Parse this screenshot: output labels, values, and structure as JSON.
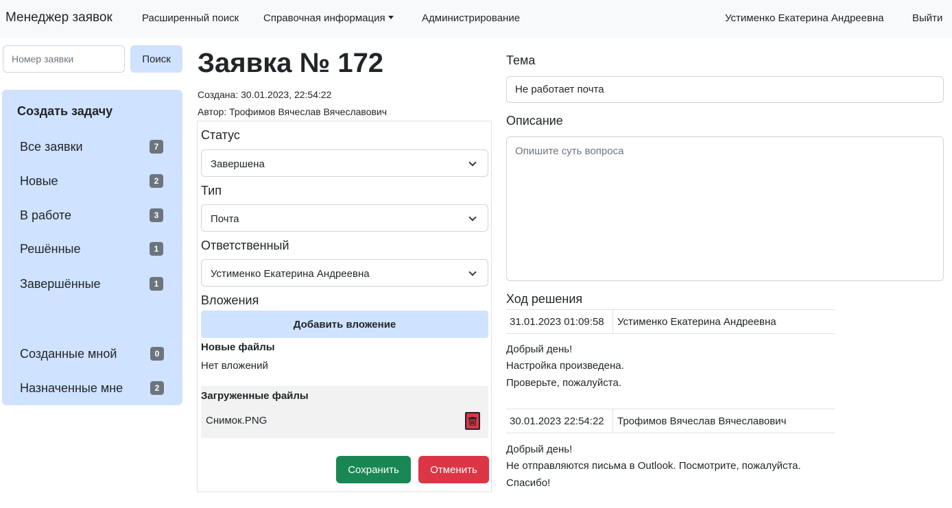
{
  "navbar": {
    "brand": "Менеджер заявок",
    "links": [
      "Расширенный поиск",
      "Справочная информация",
      "Администрирование"
    ],
    "user": "Устименко Екатерина Андреевна",
    "logout": "Выйти"
  },
  "search": {
    "placeholder": "Номер заявки",
    "button": "Поиск"
  },
  "sidebar": {
    "create_task": "Создать задачу",
    "items": [
      {
        "label": "Все заявки",
        "count": "7"
      },
      {
        "label": "Новые",
        "count": "2"
      },
      {
        "label": "В работе",
        "count": "3"
      },
      {
        "label": "Решённые",
        "count": "1"
      },
      {
        "label": "Завершённые",
        "count": "1"
      },
      {
        "label": "Созданные мной",
        "count": "0"
      },
      {
        "label": "Назначенные мне",
        "count": "2"
      }
    ]
  },
  "ticket": {
    "title": "Заявка № 172",
    "created": "Создана: 30.01.2023, 22:54:22",
    "author": "Автор: Трофимов Вячеслав Вячеславович"
  },
  "form": {
    "status_label": "Статус",
    "status_value": "Завершена",
    "type_label": "Тип",
    "type_value": "Почта",
    "assignee_label": "Ответственный",
    "assignee_value": "Устименко Екатерина Андреевна",
    "attachments_label": "Вложения",
    "add_attachment": "Добавить вложение",
    "new_files_label": "Новые файлы",
    "no_attachments": "Нет вложений",
    "uploaded_label": "Загруженные файлы",
    "uploaded_file": "Снимок.PNG",
    "save": "Сохранить",
    "cancel": "Отменить"
  },
  "details": {
    "topic_label": "Тема",
    "topic_value": "Не работает почта",
    "description_label": "Описание",
    "description_placeholder": "Опишите суть вопроса",
    "progress_label": "Ход решения"
  },
  "log": [
    {
      "date": "31.01.2023 01:09:58",
      "author": "Устименко Екатерина Андреевна",
      "lines": [
        "Добрый день!",
        "Настройка произведена.",
        "Проверьте, пожалуйста."
      ]
    },
    {
      "date": "30.01.2023 22:54:22",
      "author": "Трофимов Вячеслав Вячеславович",
      "lines": [
        "Добрый день!",
        "Не отправляются письма в Outlook. Посмотрите, пожалуйста.",
        "Спасибо!"
      ]
    }
  ],
  "colors": {
    "primary_subtle": "#cfe2ff",
    "badge": "#6c757d",
    "success": "#198754",
    "danger": "#dc3545"
  }
}
